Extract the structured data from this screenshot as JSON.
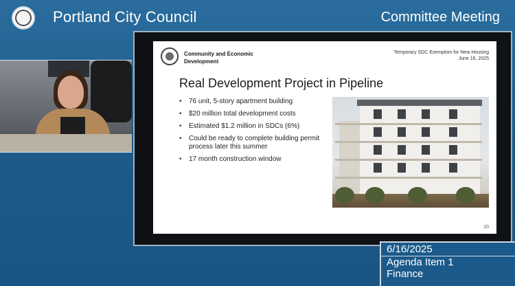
{
  "header": {
    "title": "Portland City Council",
    "meeting_type": "Committee Meeting"
  },
  "slide": {
    "department": "Community and Economic Development",
    "meta_title": "Temporary SDC Exemption for New Housing",
    "meta_date": "June 16, 2025",
    "title": "Real Development Project in Pipeline",
    "bullets": [
      "76 unit, 5-story apartment building",
      "$20 million total development costs",
      "Estimated $1.2 million in SDCs (6%)",
      "Could be ready to complete building permit process later this summer",
      "17 month construction window"
    ],
    "page_number": "20"
  },
  "lower_third": {
    "date": "6/16/2025",
    "agenda_item": "Agenda Item 1",
    "topic": "Finance"
  },
  "colors": {
    "background": "#1f5f8f",
    "text": "#ffffff"
  }
}
